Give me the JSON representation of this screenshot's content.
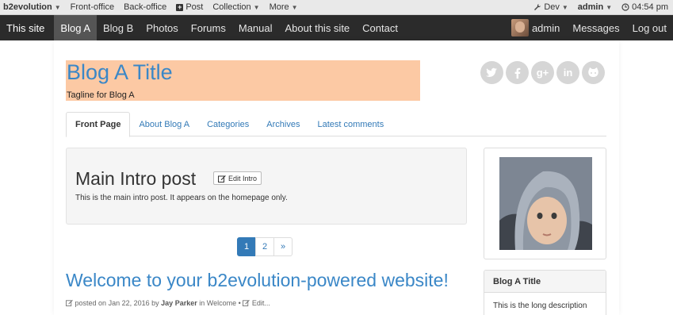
{
  "admin_bar": {
    "brand": "b2evolution",
    "items": [
      "Front-office",
      "Back-office",
      "Post",
      "Collection",
      "More"
    ],
    "dev": "Dev",
    "user": "admin",
    "time": "04:54 pm"
  },
  "main_nav": {
    "site": "This site",
    "items": [
      "Blog A",
      "Blog B",
      "Photos",
      "Forums",
      "Manual",
      "About this site",
      "Contact"
    ],
    "user": "admin",
    "messages": "Messages",
    "logout": "Log out"
  },
  "header": {
    "title": "Blog A Title",
    "tagline": "Tagline for Blog A",
    "highlight_color": "#fcc9a4",
    "title_color": "#3a87c7"
  },
  "social_icons": [
    "twitter-icon",
    "facebook-icon",
    "google-plus-icon",
    "linkedin-icon",
    "github-icon"
  ],
  "tabs": [
    "Front Page",
    "About Blog A",
    "Categories",
    "Archives",
    "Latest comments"
  ],
  "intro": {
    "title": "Main Intro post",
    "edit_label": "Edit Intro",
    "body": "This is the main intro post. It appears on the homepage only."
  },
  "pagination": {
    "pages": [
      "1",
      "2"
    ],
    "next": "»",
    "current": "1"
  },
  "post": {
    "title": "Welcome to your b2evolution-powered website!",
    "meta_prefix": "posted on",
    "date": "Jan 22, 2016",
    "by": "by",
    "author": "Jay Parker",
    "in": "in",
    "category": "Welcome",
    "sep": "•",
    "edit": "Edit..."
  },
  "sidebar": {
    "widget_title": "Blog A Title",
    "widget_body": "This is the long description"
  }
}
